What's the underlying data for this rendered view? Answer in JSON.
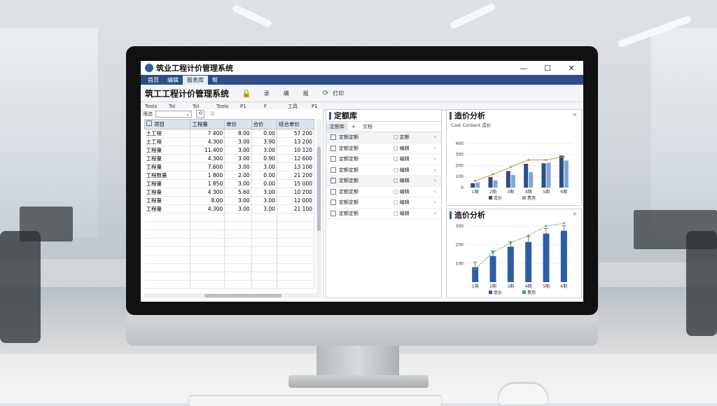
{
  "window": {
    "title": "筑业工程计价管理系统",
    "min": "—",
    "max": "☐",
    "close": "✕"
  },
  "menu": {
    "items": [
      {
        "label": "首页"
      },
      {
        "label": "编辑"
      },
      {
        "label": "报表库"
      },
      {
        "label": "帮"
      }
    ],
    "active_index": 2
  },
  "toolbar": {
    "heading": "筑工工程计价管理系统",
    "tools": [
      {
        "label": "录"
      },
      {
        "label": "编"
      },
      {
        "label": "报"
      }
    ],
    "print_label": "打印"
  },
  "subtoolbar": {
    "items": [
      "Tools",
      "Tol",
      "Tol",
      "Tools",
      "P1",
      "F",
      "工具",
      "P1"
    ]
  },
  "filter": {
    "label": "筛选",
    "select_value": ""
  },
  "cost_table": {
    "columns": [
      "项目",
      "工程量",
      "单价",
      "合价",
      "综合单价"
    ],
    "rows": [
      [
        "土工程",
        "7 400",
        "8.00",
        "0.00",
        "57 200"
      ],
      [
        "土工程",
        "4.300",
        "3.00",
        "3.90",
        "13 200"
      ],
      [
        "工程量",
        "11.400",
        "3.00",
        "3.00",
        "10 120"
      ],
      [
        "工程量",
        "4.300",
        "3.00",
        "0.90",
        "12 600"
      ],
      [
        "工程量",
        "7.600",
        "3.00",
        "3.00",
        "13 100"
      ],
      [
        "工程数量",
        "1 800",
        "2.00",
        "0.00",
        "21 200"
      ],
      [
        "工程量",
        "1 850",
        "3.00",
        "0.00",
        "15 000"
      ],
      [
        "工程量",
        "4 300",
        "5.60",
        "3.00",
        "10 200"
      ],
      [
        "工程量",
        "8.00",
        "3.00",
        "3.00",
        "12 000"
      ],
      [
        "工程量",
        "4.300",
        "3.00",
        "3.00",
        "21 100"
      ]
    ]
  },
  "norm_library": {
    "title": "定额库",
    "tabs": [
      {
        "label": "定额库"
      },
      {
        "label": "+"
      },
      {
        "label": "文档"
      }
    ],
    "items": [
      {
        "name": "定额定额",
        "tag": "定额"
      },
      {
        "name": "定额定额",
        "tag": "编辑"
      },
      {
        "name": "定额定额",
        "tag": "编辑"
      },
      {
        "name": "定额定额",
        "tag": "编辑"
      },
      {
        "name": "定额定额",
        "tag": "编辑"
      },
      {
        "name": "定额定额",
        "tag": "编辑"
      },
      {
        "name": "定额定额",
        "tag": "编辑"
      },
      {
        "name": "定额定额",
        "tag": "编辑"
      }
    ]
  },
  "chart_top": {
    "title": "造价分析",
    "subtitle": "Cost Content 造价",
    "close": "×"
  },
  "chart_bottom": {
    "title": "造价分析",
    "close": "×"
  },
  "chart_data": [
    {
      "type": "bar",
      "title": "造价分析",
      "categories": [
        "1期",
        "2期",
        "3期",
        "4期",
        "5期",
        "6期"
      ],
      "series": [
        {
          "name": "造价",
          "values": [
            40,
            95,
            150,
            215,
            220,
            290
          ]
        },
        {
          "name": "费用",
          "values": [
            45,
            65,
            115,
            140,
            225,
            245
          ]
        },
        {
          "name": "",
          "values": [
            60,
            120,
            185,
            250,
            250,
            280
          ]
        }
      ],
      "ylim": [
        0,
        500
      ],
      "yticks": [
        0,
        100,
        200,
        300,
        400
      ],
      "legend": [
        "造价",
        "费用"
      ],
      "legend_position": "bottom",
      "colors": [
        "#2b4d83",
        "#7ea5d6",
        "#e08b2c"
      ]
    },
    {
      "type": "bar",
      "title": "造价分析",
      "categories": [
        "1期",
        "2期",
        "3期",
        "4期",
        "5期",
        "6期"
      ],
      "series": [
        {
          "name": "造价",
          "values": [
            80,
            140,
            190,
            215,
            260,
            275
          ]
        },
        {
          "name": "",
          "values": [
            70,
            160,
            210,
            250,
            300,
            315
          ]
        }
      ],
      "ylim": [
        0,
        300
      ],
      "yticks": [
        100,
        200,
        300,
        310
      ],
      "legend": [
        "造价",
        "费用"
      ],
      "legend_position": "bottom",
      "colors": [
        "#2b5ea6",
        "#3aa36b"
      ]
    }
  ]
}
